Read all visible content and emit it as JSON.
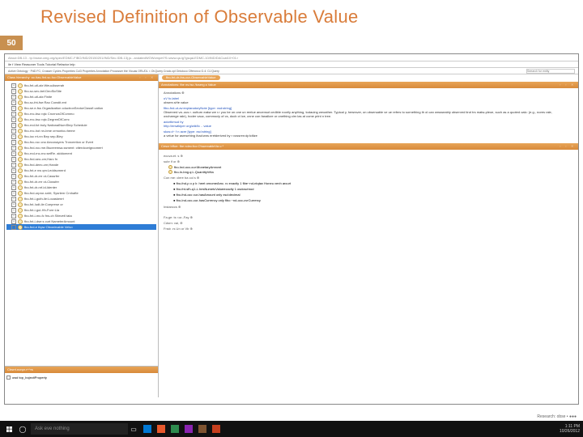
{
  "title": "Revised Definition of Observable Value",
  "badge": "50",
  "window": {
    "url": "About:DB-13 - tp://www.omg.org/spec/EDMC-FIBO/IND/20150201/IND/Sec.IDB-13j.jo...andatedWOWompet?S=www.qa.ig?gsqaLEDMC-10/IND/DACcat10+01>",
    "menu": "ile  t  View Reasoner Tools  Tutorial  Refactor  lelp",
    "active_label": "Active Ontology",
    "active_value": "PdD FC; Crosser Cycles Properties  Col3 Properties  Annotation Proocsser  the Vicuas  ORL/DL  < Ot.Query Crook.cpl  Ontoloco Cfferoncc G.4:  CL'Query",
    "search_placeholder": "Seearch for entity"
  },
  "class_hierarchy": {
    "header": "Class hierarchy :oc.tias-fint-sc-foc:ObservableValue",
    "items": [
      "fbo-fnt-utl-alx:WeucAsserah",
      "fbo-sc-sec-bel:DeoSicSite",
      "fbo-fnt-utl-alx:Finite",
      "fbo-sc-fnt-fse:Rao Constit.ent",
      "fbo-se.e-fss Orgaslization cductronSectorClassfi catlon",
      "fbo-rnc-bsc rqtc CncrncsOfCcmmo",
      "fbo-rnc-bsc rqtc.DegreeDfCorrc",
      "fbo-rnd-fot truty NationalNumStep Schedule",
      "fbo-rnc-hot nn-bme crmontcu:heme",
      "fbo-ioc rrt-nn Bep sep-Bley",
      "fbo-fnc-roc ono Aeconayers Trorceetion or Evert",
      "fbo-fnd-roc.rne.Bscreemsa.ssment: ctterdcceigroomert",
      "fbo-rnd-rnc-rnc:setRe.  alddoment",
      "fbo-fnd-seo-crn;Harc fn",
      "fbo-fnd-deec-crn;Hande",
      "fbo-fnt-e nw qm:Leddscmerd",
      "fbo-fnt-dr-err ot-Cassrfer",
      "fbo-fnt-dr-err ot-Clossfer",
      "fbo-fnt-dr-nrf-id-ldenter",
      "fbo-fnd-orpror-snht; Sysrtem Crnhafte",
      "fbo-fnt-i-guth-ile:Locaskenrt",
      "fbo-fnt-!udt-ile:Coeprese or",
      "fbo-fnt-i-gul-Hh-Forrr:Lla",
      "fbo-fnt-i-mc-fc fns-ch Sitevetl tata",
      "fbo-fnt-i-dse:s curt NameterAmount",
      "fbo-fnd-e thpw Obxwirvable Velvo"
    ],
    "selected": 25
  },
  "properties_panel": {
    "header": "Cbsrrt.ncnpr.r+^rs"
  },
  "object_prop": {
    "label": "owd top_bojectiProperty"
  },
  "right_top_button": "fbo-fnt-dr-fns-cur-ObservahleValue",
  "ann_header": "Annotations: fbe ns.tsc /tcserg.s Value",
  "annotations": {
    "sect": "Annotations",
    "label": "uV fo.label",
    "label_val": "observ.sHe value",
    "expl_k": "fibo-fnd-ut-av:explanatoryNote  [type: xsd:string]",
    "expl_val": "Observed va..ous r. outturn eakw we r.r you be on one un reelue ancensot cedible roorily anything, todauing weoather. Typical y, hewrsver, on obsersable ve ue refers to sornething th ol can wrssseably observed tirot trs matw-pleoe, such as a quoted oalc: (e.g., nores rale, oxcharnge rale), hoder vauc, commociy of cs, docb ct ice, cnne con fanallcre or onething cirn las at come print n tree.",
    "iri_k": "adortbmud hy",
    "iri_val": "http://enwikiper org/wikf/c .. value",
    "def_k": "skos:d~ f n acre  [type: xsd:string]",
    "def_val": "a velue for asmsehing ihad:wns eretderived by r vossren:dp!cltize"
  },
  "desc_header": "Cescr bffoe: fbe ndec:fco:O'sservableVa u  *",
  "desc": {
    "equiv": "ecuva.et. s",
    "subof": "subr if or",
    "sub1": "fbo-Ind-occ-cur:MonetaryAmnvnt",
    "sub2": "fbo-ln-bng.q:L.QuantityVrlta",
    "gca": "Con me: clere ba col s",
    "gca1": "fbo-fnd-p o p lr. heet ornomeAmc. rc exactly 1 fibe~nd-ntqtax Honeu venh arcurt",
    "gca2": "fbo-fnt-sfh-q1-L.hesNumetcValueexactly 1 osdcschrod",
    "gca3": "fbo-fnd-occ cur-hasAmount only xsd:decimal",
    "gca4": "fbo-Ind-occ-cur-hasCurrency only fibo ~nd-occ-cvrCurrercy",
    "inst": "Instanccs",
    "target": "Fa.ge: ts <or.-Fay",
    "disjw": "Cdsrn: vai,",
    "disju": "Fnsb .rs Un  or Vb"
  },
  "taskbar": {
    "search": "Ask eve nothing",
    "time": "1:11 PM",
    "date": "10/26/2012",
    "app_colors": [
      "#0078d4",
      "#e8582c",
      "#2e8a4e",
      "#8a24b0",
      "#7e5330",
      "#c63f1e"
    ]
  }
}
